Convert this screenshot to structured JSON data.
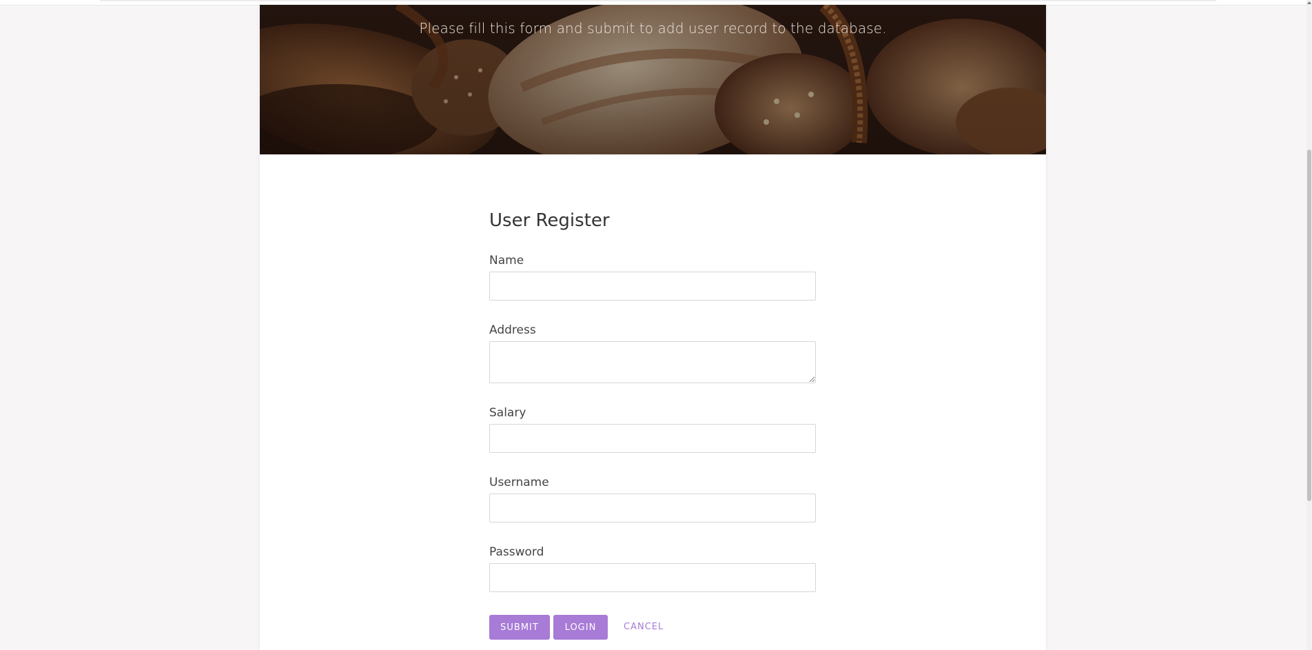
{
  "hero": {
    "message": "Please fill this form and submit to add user record to the database."
  },
  "form": {
    "title": "User Register",
    "fields": {
      "name": {
        "label": "Name",
        "value": ""
      },
      "address": {
        "label": "Address",
        "value": ""
      },
      "salary": {
        "label": "Salary",
        "value": ""
      },
      "username": {
        "label": "Username",
        "value": ""
      },
      "password": {
        "label": "Password",
        "value": ""
      }
    },
    "actions": {
      "submit": "SUBMIT",
      "login": "LOGIN",
      "cancel": "CANCEL"
    }
  },
  "colors": {
    "accent": "#a77bd6",
    "page_bg": "#f7f5f6",
    "hero_tint": "#3a241a"
  }
}
